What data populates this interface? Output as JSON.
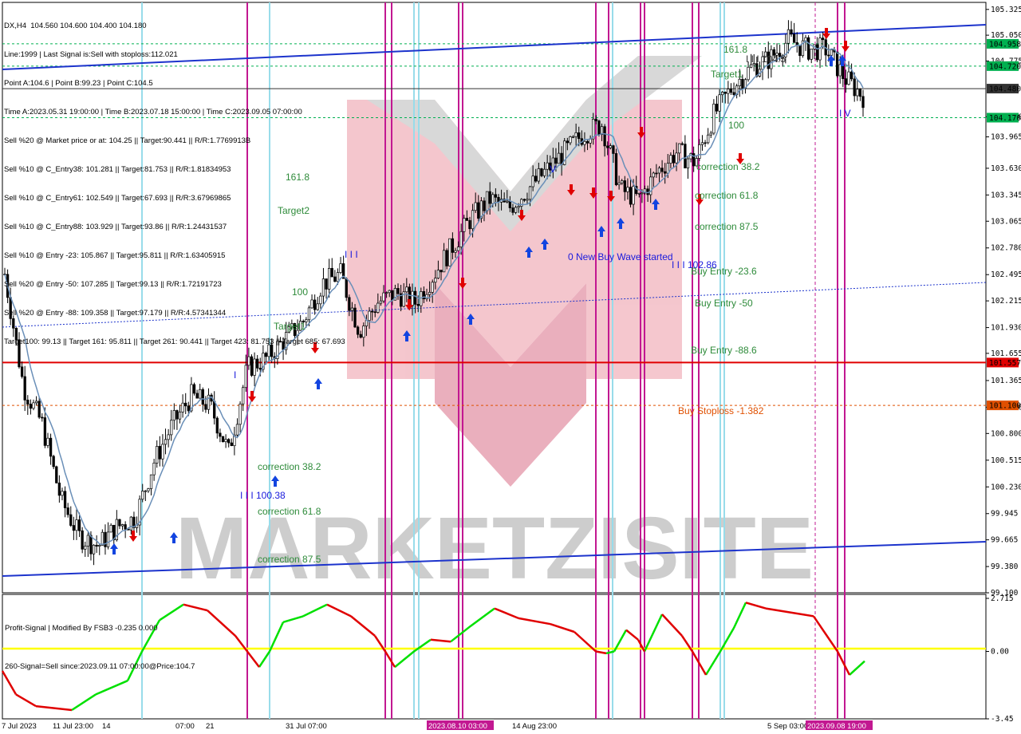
{
  "header": {
    "symbol_line": "DX,H4  104.560 104.600 104.400 104.180",
    "lines": [
      "Line:1999 | Last Signal is:Sell with stoploss:112.021",
      "Point A:104.6 | Point B:99.23 | Point C:104.5",
      "Time A:2023.05.31 19:00:00 | Time B:2023.07.18 15:00:00 | Time C:2023.09.05 07:00:00",
      "Sell %20 @ Market price or at: 104.25 || Target:90.441 || R/R:1.7769913B",
      "Sell %10 @ C_Entry38: 101.281 || Target:81.753 || R/R:1.81834953",
      "Sell %10 @ C_Entry61: 102.549 || Target:67.693 || R/R:3.67969865",
      "Sell %10 @ C_Entry88: 103.929 || Target:93.86 || R/R:1.24431537",
      "Sell %10 @ Entry -23: 105.867 || Target:95.811 || R/R:1.63405915",
      "Sell %20 @ Entry -50: 107.285 || Target:99.13 || R/R:1.72191723",
      "Sell %20 @ Entry -88: 109.358 || Target:97.179 || R/R:4.57341344",
      "Target100: 99.13 || Target 161: 95.811 || Target 261: 90.441 || Target 423: 81.753 || Target 685: 67.693"
    ]
  },
  "watermark": "MARKETZISITE",
  "price_axis": {
    "ticks": [
      "105.325",
      "105.050",
      "104.775",
      "104.180",
      "103.965",
      "103.630",
      "103.345",
      "103.065",
      "102.780",
      "102.495",
      "102.215",
      "101.930",
      "101.655",
      "101.365",
      "101.080",
      "100.800",
      "100.515",
      "100.230",
      "99.945",
      "99.665",
      "99.380",
      "99.100"
    ],
    "labels": [
      {
        "text": "104.958",
        "color": "#00b050"
      },
      {
        "text": "104.720",
        "color": "#00b050"
      },
      {
        "text": "104.480",
        "color": "#333333"
      },
      {
        "text": "104.170",
        "color": "#00b050"
      },
      {
        "text": "101.557",
        "color": "#e00000"
      },
      {
        "text": "101.100",
        "color": "#e05000"
      }
    ]
  },
  "time_axis": {
    "labels": [
      "7 Jul 2023",
      "11 Jul 23:00",
      "14",
      "07:00",
      "21",
      "31 Jul 07:00",
      "14 Aug 23:00",
      "5 Sep 03:00"
    ],
    "highlighted": [
      "2023.08.10 03:00",
      "2023.09.08 19:00"
    ],
    "highlight_color": "#c21891"
  },
  "levels": [
    {
      "text": "161.8",
      "color": "#2e8b3a"
    },
    {
      "text": "Target2",
      "color": "#2e8b3a"
    },
    {
      "text": "100",
      "color": "#2e8b3a"
    },
    {
      "text": "Target1",
      "color": "#2e8b3a"
    },
    {
      "text": "161.8",
      "color": "#2e8b3a"
    },
    {
      "text": "Target1",
      "color": "#2e8b3a"
    },
    {
      "text": "100",
      "color": "#2e8b3a"
    },
    {
      "text": "correction 38.2",
      "color": "#2e8b3a"
    },
    {
      "text": "correction 61.8",
      "color": "#2e8b3a"
    },
    {
      "text": "correction 87.5",
      "color": "#2e8b3a"
    },
    {
      "text": "correction 38.2",
      "color": "#2e8b3a"
    },
    {
      "text": "correction 61.8",
      "color": "#2e8b3a"
    },
    {
      "text": "correction 87.5",
      "color": "#2e8b3a"
    },
    {
      "text": "Buy Entry -23.6",
      "color": "#2e8b3a"
    },
    {
      "text": "Buy Entry -50",
      "color": "#2e8b3a"
    },
    {
      "text": "Buy Entry -88.6",
      "color": "#2e8b3a"
    },
    {
      "text": "Buy Stoploss -1.382",
      "color": "#e05000"
    },
    {
      "text": "0 New Buy Wave started",
      "color": "#1a1adc"
    },
    {
      "text": "I I I 102.86",
      "color": "#1a1adc"
    },
    {
      "text": "I I I 100.38",
      "color": "#1a1adc"
    },
    {
      "text": "I I I 104.5",
      "color": "#333333"
    },
    {
      "text": "I I I",
      "color": "#1a1adc"
    },
    {
      "text": "I",
      "color": "#1a1adc"
    },
    {
      "text": "V",
      "color": "#1a1adc"
    },
    {
      "text": "I V",
      "color": "#1a1adc"
    }
  ],
  "subwindow": {
    "title": "Profit-Signal | Modified By FSB3 -0.235 0.000",
    "signal_line": "260-Signal=Sell since:2023.09.11 07:00:00@Price:104.7",
    "ticks": [
      "2.715",
      "0.00",
      "-3.45"
    ],
    "colors": {
      "rising": "#00e000",
      "falling": "#e00000",
      "zero": "#ffff00"
    }
  },
  "colors": {
    "bull_candle": "#000000",
    "bear_candle": "#000000",
    "channel": "#1c33cc",
    "ma": "#6a8fb8",
    "vline_magenta": "#c21891",
    "vline_cyan": "#98dcea",
    "buy_arrow": "#1244e0",
    "sell_arrow": "#e00000"
  },
  "chart_data": {
    "type": "candlestick",
    "symbol": "DX",
    "timeframe": "H4",
    "close_path": [
      {
        "t": "2023-07-07",
        "close": 102.5
      },
      {
        "t": "2023-07-10",
        "close": 101.3
      },
      {
        "t": "2023-07-11",
        "close": 100.9
      },
      {
        "t": "2023-07-12",
        "close": 100.1
      },
      {
        "t": "2023-07-13",
        "close": 99.7
      },
      {
        "t": "2023-07-14",
        "close": 99.6
      },
      {
        "t": "2023-07-17",
        "close": 99.8
      },
      {
        "t": "2023-07-18",
        "close": 99.9
      },
      {
        "t": "2023-07-19",
        "close": 100.5
      },
      {
        "t": "2023-07-20",
        "close": 100.9
      },
      {
        "t": "2023-07-21",
        "close": 101.2
      },
      {
        "t": "2023-07-24",
        "close": 101.1
      },
      {
        "t": "2023-07-25",
        "close": 100.6
      },
      {
        "t": "2023-07-26",
        "close": 101.5
      },
      {
        "t": "2023-07-27",
        "close": 101.6
      },
      {
        "t": "2023-07-28",
        "close": 101.8
      },
      {
        "t": "2023-07-31",
        "close": 102.0
      },
      {
        "t": "2023-08-01",
        "close": 102.4
      },
      {
        "t": "2023-08-02",
        "close": 102.5
      },
      {
        "t": "2023-08-03",
        "close": 101.9
      },
      {
        "t": "2023-08-04",
        "close": 102.2
      },
      {
        "t": "2023-08-07",
        "close": 102.3
      },
      {
        "t": "2023-08-08",
        "close": 102.2
      },
      {
        "t": "2023-08-09",
        "close": 102.5
      },
      {
        "t": "2023-08-10",
        "close": 102.8
      },
      {
        "t": "2023-08-11",
        "close": 103.1
      },
      {
        "t": "2023-08-14",
        "close": 103.3
      },
      {
        "t": "2023-08-15",
        "close": 103.2
      },
      {
        "t": "2023-08-16",
        "close": 103.4
      },
      {
        "t": "2023-08-17",
        "close": 103.6
      },
      {
        "t": "2023-08-18",
        "close": 103.8
      },
      {
        "t": "2023-08-21",
        "close": 104.0
      },
      {
        "t": "2023-08-22",
        "close": 104.1
      },
      {
        "t": "2023-08-23",
        "close": 103.4
      },
      {
        "t": "2023-08-24",
        "close": 103.3
      },
      {
        "t": "2023-08-25",
        "close": 103.6
      },
      {
        "t": "2023-08-28",
        "close": 103.8
      },
      {
        "t": "2023-08-29",
        "close": 103.7
      },
      {
        "t": "2023-08-30",
        "close": 104.2
      },
      {
        "t": "2023-08-31",
        "close": 104.5
      },
      {
        "t": "2023-09-01",
        "close": 104.7
      },
      {
        "t": "2023-09-04",
        "close": 104.8
      },
      {
        "t": "2023-09-05",
        "close": 105.0
      },
      {
        "t": "2023-09-06",
        "close": 104.9
      },
      {
        "t": "2023-09-07",
        "close": 104.9
      },
      {
        "t": "2023-09-08",
        "close": 104.6
      },
      {
        "t": "2023-09-11",
        "close": 104.4
      }
    ],
    "horizontal_levels": [
      {
        "price": 104.958,
        "style": "dashed",
        "color": "#00b050"
      },
      {
        "price": 104.72,
        "style": "dashed",
        "color": "#00b050"
      },
      {
        "price": 104.48,
        "style": "solid",
        "color": "#333333"
      },
      {
        "price": 104.17,
        "style": "dashed",
        "color": "#00b050"
      },
      {
        "price": 101.557,
        "style": "solid",
        "color": "#e00000"
      },
      {
        "price": 101.1,
        "style": "dashed",
        "color": "#e05000"
      }
    ],
    "ylim": [
      99.1,
      105.4
    ],
    "subwindow_ylim": [
      -3.45,
      2.715
    ],
    "grid": false
  }
}
